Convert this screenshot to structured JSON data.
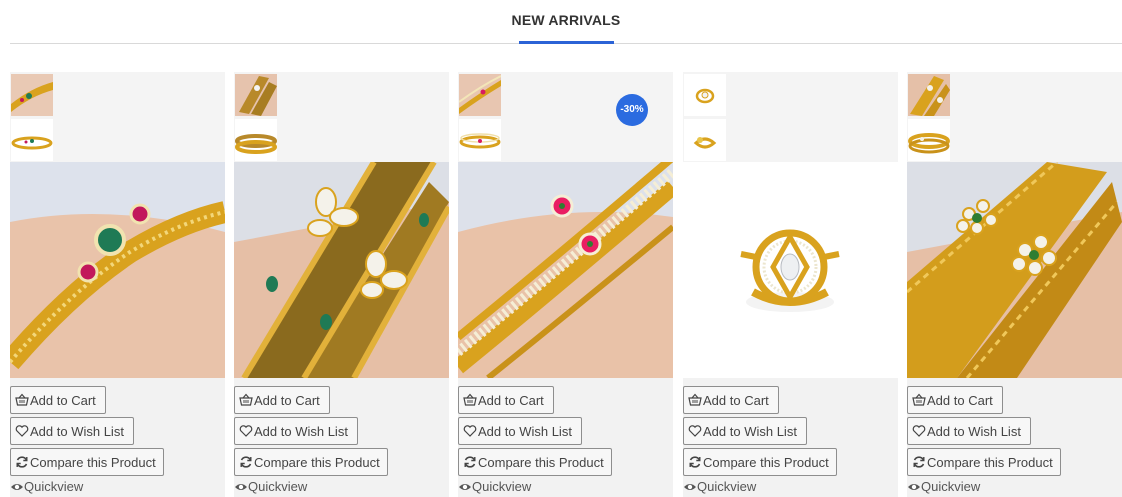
{
  "section": {
    "title": "NEW ARRIVALS"
  },
  "products": [
    {
      "cart_label": "Add to Cart",
      "wish_label": "Add to Wish List",
      "compare_label": "Compare this Product",
      "quickview_label": "Quickview",
      "badge": ""
    },
    {
      "cart_label": "Add to Cart",
      "wish_label": "Add to Wish List",
      "compare_label": "Compare this Product",
      "quickview_label": "Quickview",
      "badge": ""
    },
    {
      "cart_label": "Add to Cart",
      "wish_label": "Add to Wish List",
      "compare_label": "Compare this Product",
      "quickview_label": "Quickview",
      "badge": "-30%"
    },
    {
      "cart_label": "Add to Cart",
      "wish_label": "Add to Wish List",
      "compare_label": "Compare this Product",
      "quickview_label": "Quickview",
      "badge": ""
    },
    {
      "cart_label": "Add to Cart",
      "wish_label": "Add to Wish List",
      "compare_label": "Compare this Product",
      "quickview_label": "Quickview",
      "badge": ""
    }
  ],
  "colors": {
    "accent": "#2b63d6",
    "badge": "#2b6be0",
    "gold": "#d9a21e"
  },
  "icons": {
    "cart": "basket-icon",
    "wish": "heart-icon",
    "compare": "refresh-icon",
    "quickview": "eye-icon"
  }
}
